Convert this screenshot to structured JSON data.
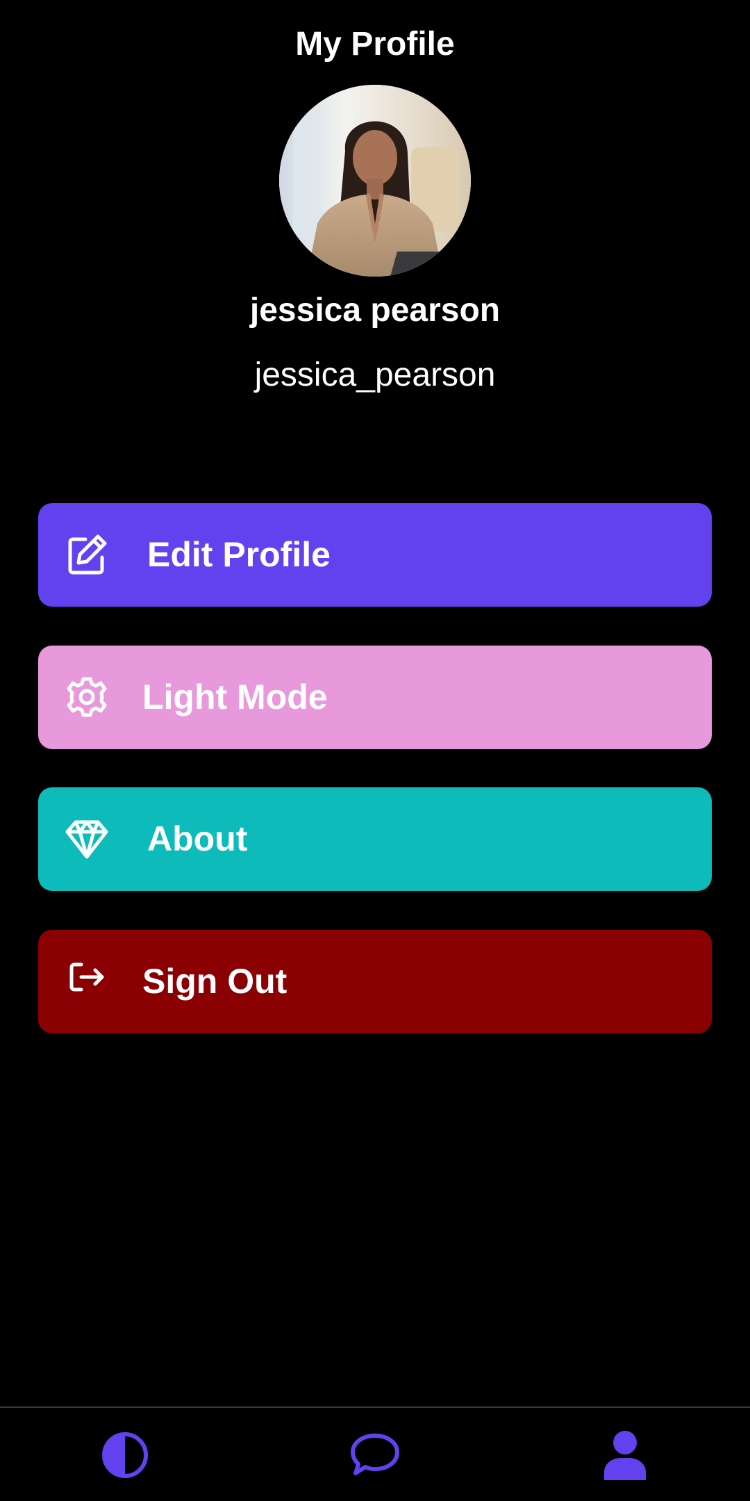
{
  "header": {
    "title": "My Profile"
  },
  "profile": {
    "display_name": "jessica pearson",
    "username": "jessica_pearson"
  },
  "menu": [
    {
      "label": "Edit Profile",
      "icon": "edit-icon",
      "color": "#6241EF"
    },
    {
      "label": "Light Mode",
      "icon": "gear-icon",
      "color": "#E899DC"
    },
    {
      "label": "About",
      "icon": "diamond-icon",
      "color": "#0EBBBB"
    },
    {
      "label": "Sign Out",
      "icon": "sign-out-icon",
      "color": "#8B0003"
    }
  ],
  "bottom_nav": [
    {
      "icon": "theme-contrast-icon",
      "color": "#6241EF"
    },
    {
      "icon": "chat-bubble-icon",
      "color": "#6241EF"
    },
    {
      "icon": "user-icon",
      "color": "#6241EF"
    }
  ],
  "colors": {
    "background": "#000000",
    "text": "#FFFFFF",
    "accent": "#6241EF"
  }
}
